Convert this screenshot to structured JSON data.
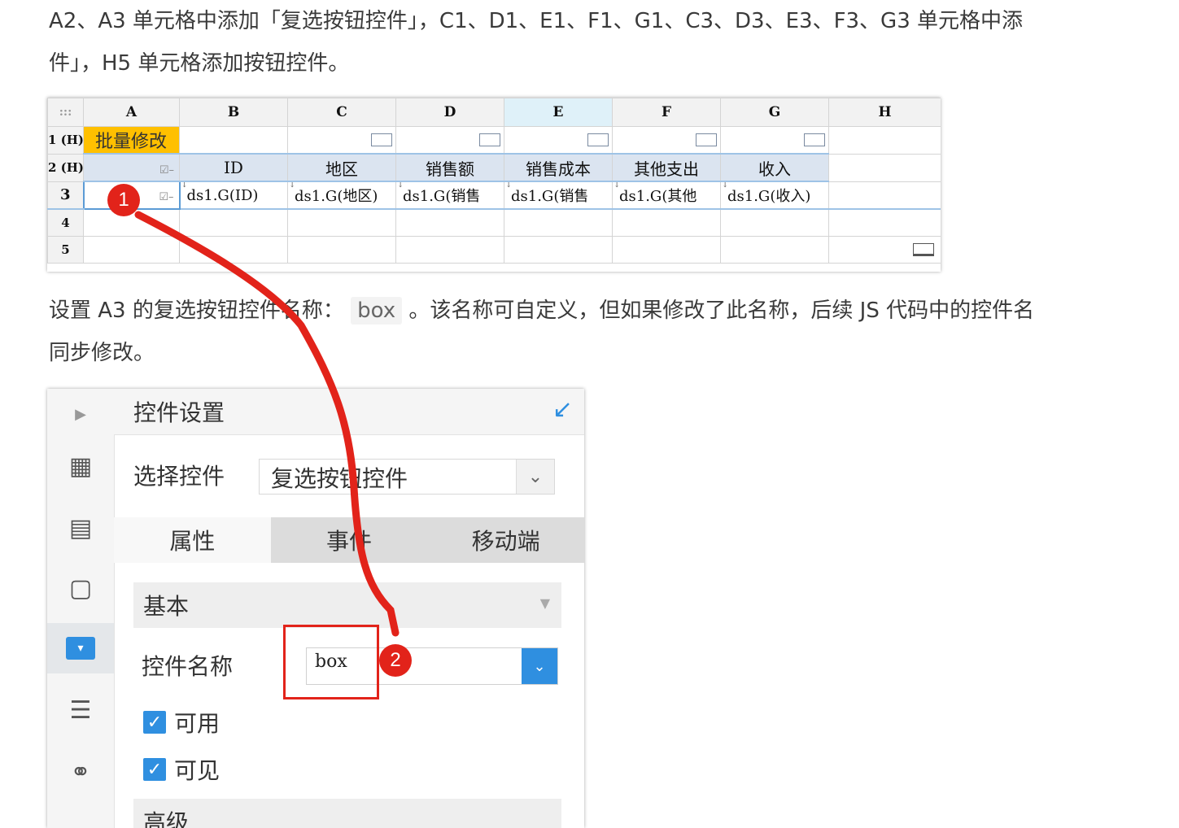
{
  "text": {
    "line1": "A2、A3 单元格中添加「复选按钮控件」，C1、D1、E1、F1、G1、C3、D3、E3、F3、G3 单元格中添",
    "line2": "件」，H5 单元格添加按钮控件。",
    "line3_a": "设置 A3 的复选按钮控件名称：",
    "line3_code": "box",
    "line3_b": "。该名称可自定义，但如果修改了此名称，后续 JS 代码中的控件名",
    "line4": "同步修改。"
  },
  "sheet": {
    "corner": ":::",
    "columns": [
      "A",
      "B",
      "C",
      "D",
      "E",
      "F",
      "G",
      "H"
    ],
    "rows": [
      "1 (H)",
      "2 (H)",
      "3",
      "4",
      "5"
    ],
    "a1": "批量修改",
    "row2": [
      "地区",
      "销售额",
      "销售成本",
      "其他支出",
      "收入"
    ],
    "row2_id": "ID",
    "row3": [
      "ds1.G(ID)",
      "ds1.G(地区)",
      "ds1.G(销售",
      "ds1.G(销售",
      "ds1.G(其他",
      "ds1.G(收入)"
    ],
    "checkbox_mark": "☑–"
  },
  "panel": {
    "title": "控件设置",
    "select_label": "选择控件",
    "select_value": "复选按钮控件",
    "tabs": [
      "属性",
      "事件",
      "移动端"
    ],
    "group_basic": "基本",
    "name_label": "控件名称",
    "name_value": "box",
    "enabled_label": "可用",
    "visible_label": "可见",
    "group_advanced": "高级"
  },
  "annotations": {
    "badge1": "1",
    "badge2": "2",
    "accent": "#e2231a"
  },
  "icons": [
    "collapse-arrow-icon",
    "cell-icon",
    "cell-info-icon",
    "frame-icon",
    "widget-icon",
    "layout-icon",
    "link-icon",
    "chevron-down-icon",
    "checkmark-icon"
  ]
}
